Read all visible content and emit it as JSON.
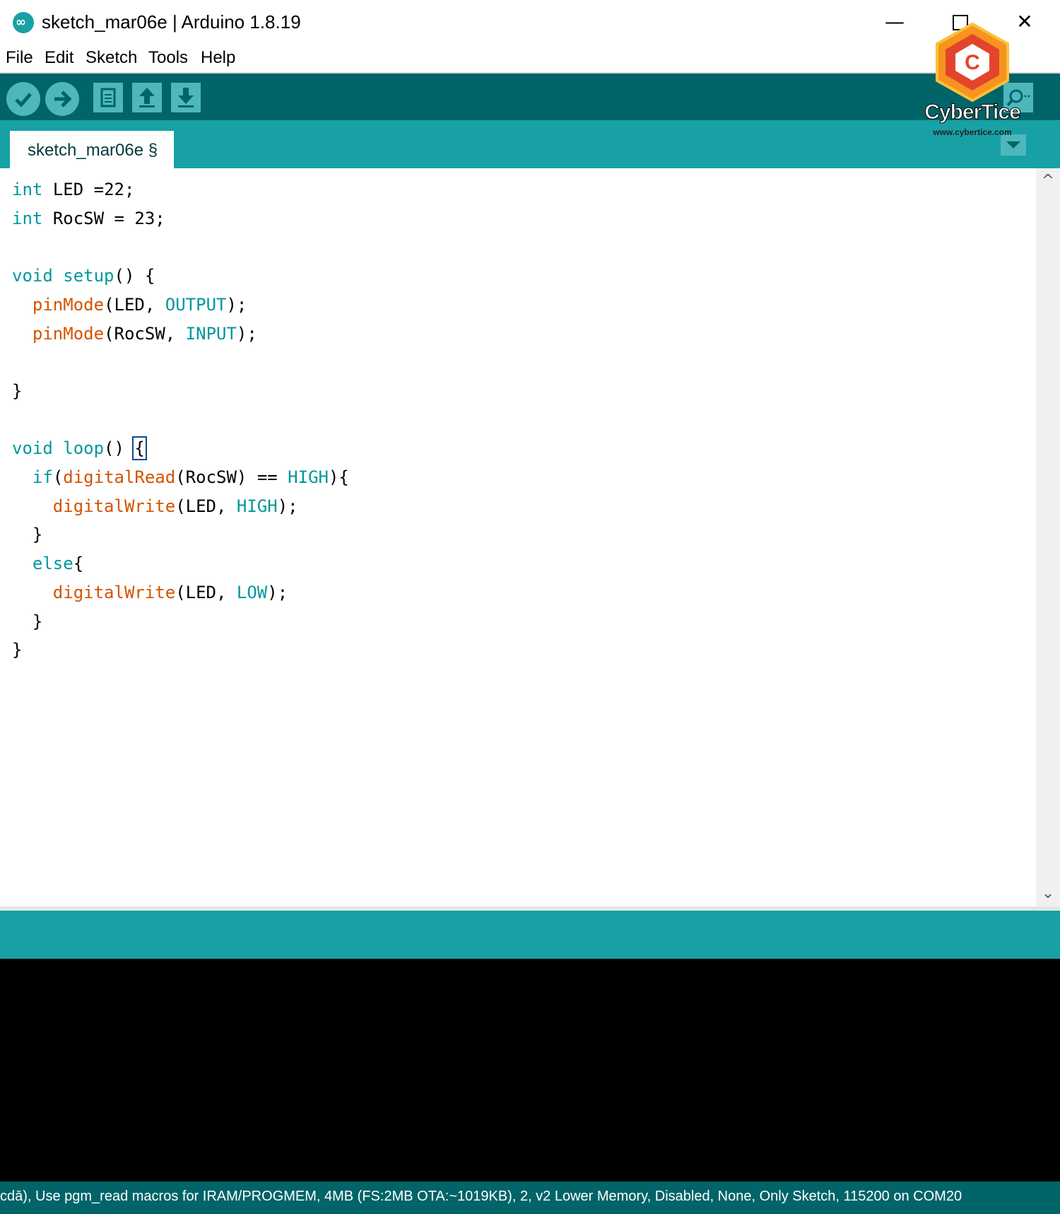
{
  "window": {
    "title": "sketch_mar06e | Arduino 1.8.19",
    "minimize_glyph": "—",
    "close_glyph": "✕"
  },
  "menu": [
    "File",
    "Edit",
    "Sketch",
    "Tools",
    "Help"
  ],
  "toolbar": {
    "buttons": [
      "verify-icon",
      "upload-icon",
      "new-icon",
      "open-icon",
      "save-icon"
    ],
    "right": "serial-monitor-icon"
  },
  "tabs": [
    {
      "label": "sketch_mar06e §"
    }
  ],
  "editor": {
    "code_lines": [
      "int LED =22;",
      "int RocSW = 23;",
      "",
      "void setup() {",
      "  pinMode(LED, OUTPUT);",
      "  pinMode(RocSW, INPUT);",
      "",
      "}",
      "",
      "void loop() {",
      "  if(digitalRead(RocSW) == HIGH){",
      "    digitalWrite(LED, HIGH);",
      "  }",
      "  else{",
      "    digitalWrite(LED, LOW);",
      "  }",
      "}"
    ],
    "scroll_up_glyph": "^",
    "scroll_down_glyph": "⌄"
  },
  "status_bar": {
    "text": "cdā), Use pgm_read macros for IRAM/PROGMEM, 4MB (FS:2MB OTA:~1019KB), 2, v2 Lower Memory, Disabled, None, Only Sketch, 115200 on COM20"
  },
  "watermark": {
    "name": "CyberTice",
    "url": "www.cybertice.com",
    "letter": "C"
  },
  "colors": {
    "toolbar": "#006468",
    "tabbar": "#17a1a5",
    "button": "#4db7bb",
    "keyword": "#00979c",
    "function": "#d35400",
    "console": "#000000"
  }
}
